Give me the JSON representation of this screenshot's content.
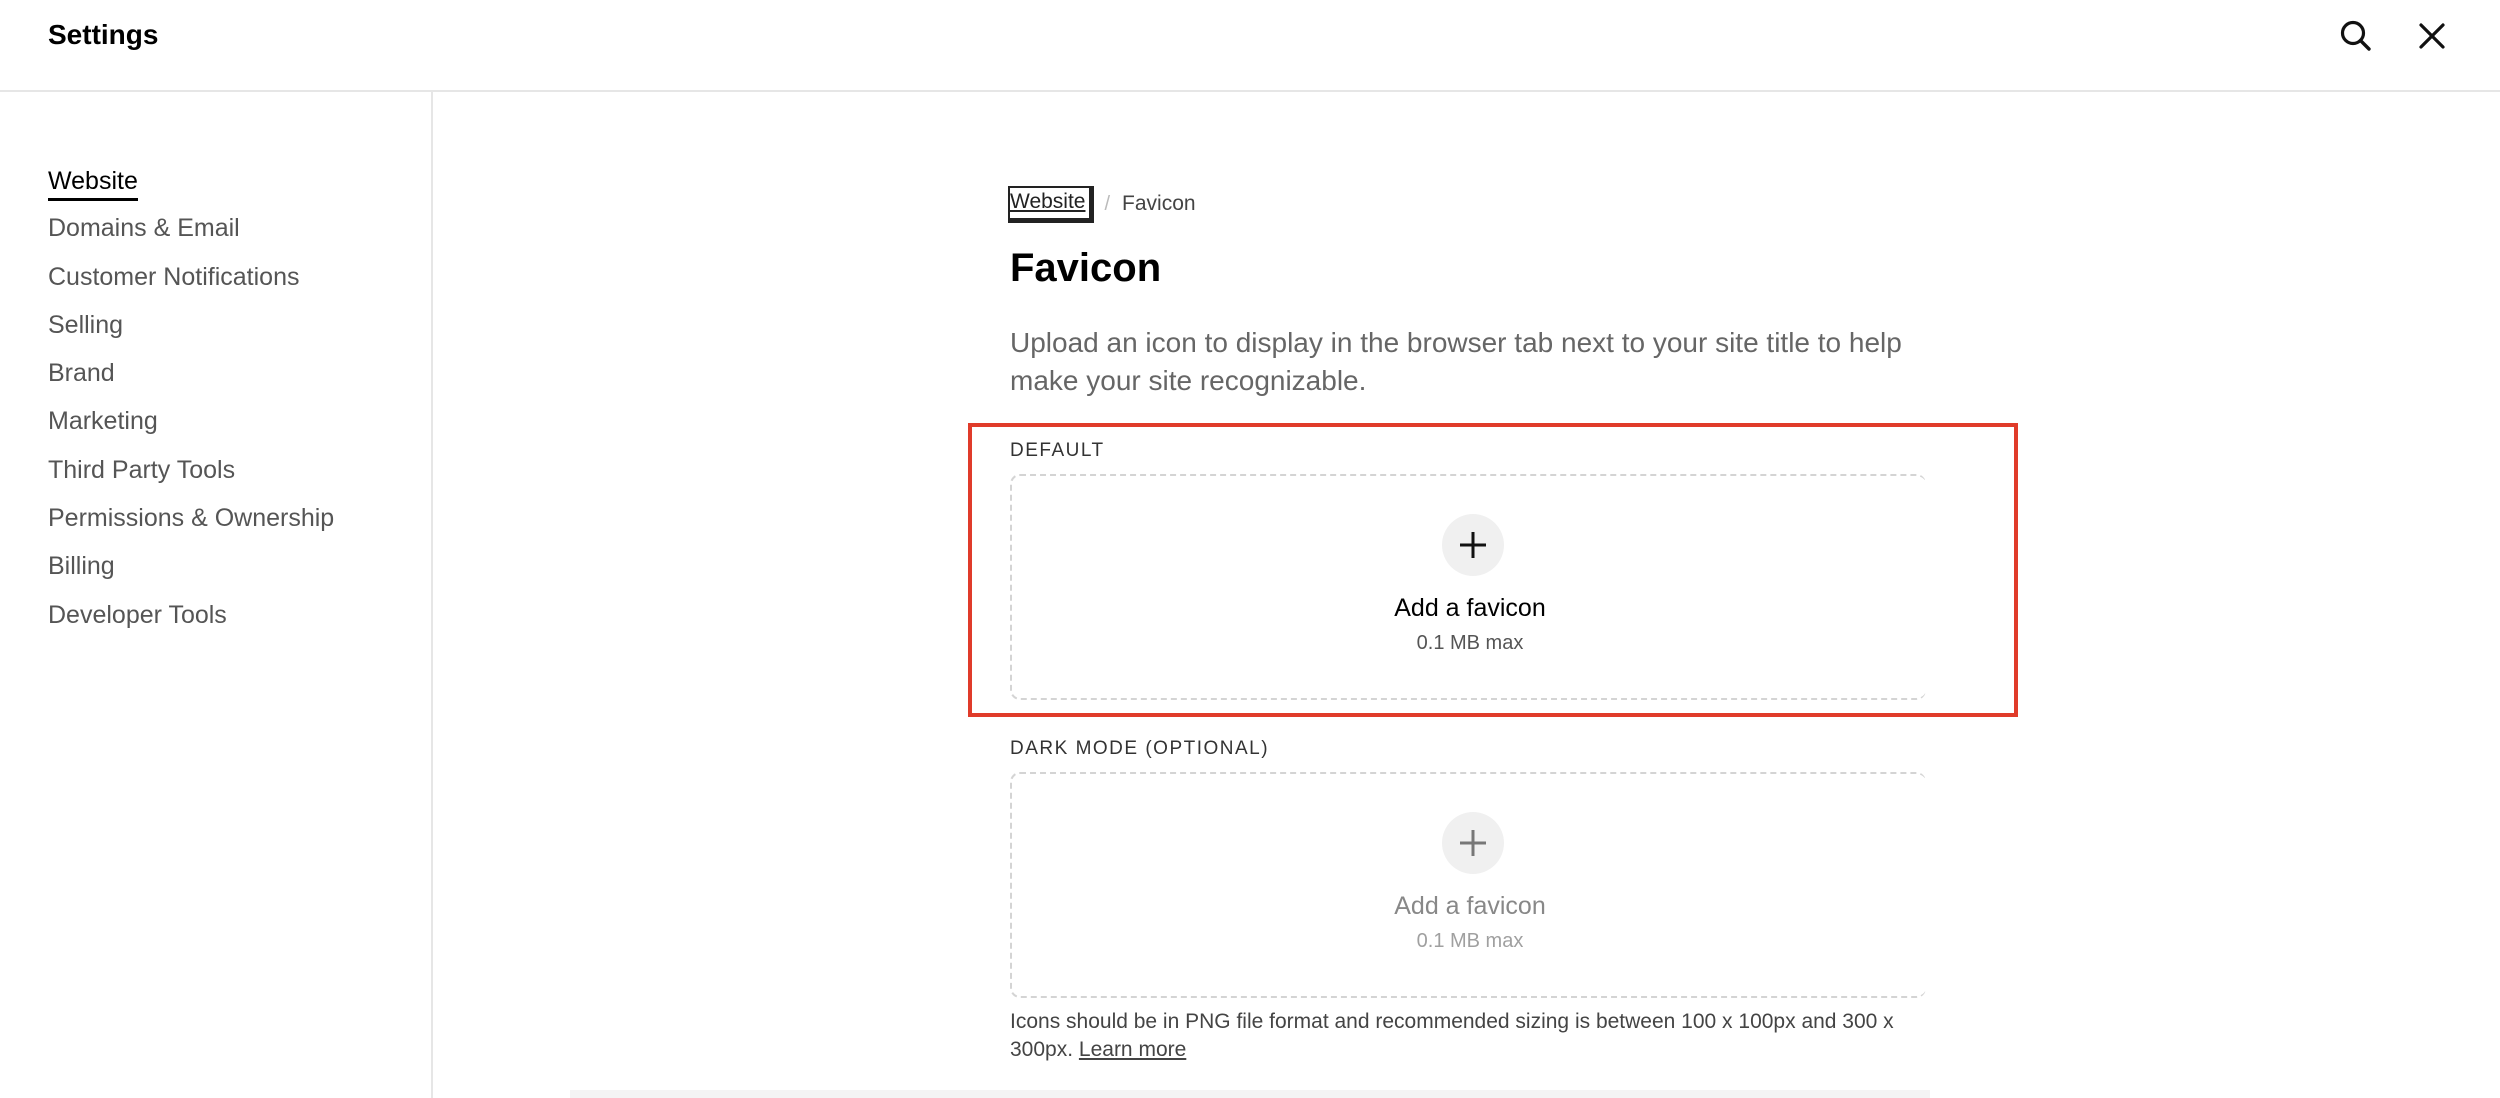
{
  "header": {
    "title": "Settings",
    "search_icon": "search-icon",
    "close_icon": "close-icon"
  },
  "sidebar": {
    "items": [
      {
        "label": "Website",
        "active": true
      },
      {
        "label": "Domains & Email"
      },
      {
        "label": "Customer Notifications"
      },
      {
        "label": "Selling"
      },
      {
        "label": "Brand"
      },
      {
        "label": "Marketing"
      },
      {
        "label": "Third Party Tools"
      },
      {
        "label": "Permissions & Ownership"
      },
      {
        "label": "Billing"
      },
      {
        "label": "Developer Tools"
      }
    ]
  },
  "breadcrumb": {
    "parent": "Website",
    "separator": "/",
    "current": "Favicon"
  },
  "main": {
    "title": "Favicon",
    "description": "Upload an icon to display in the browser tab next to your site title to help make your site recognizable.",
    "default_section": {
      "label": "DEFAULT",
      "upload_title": "Add a favicon",
      "upload_sub": "0.1 MB max"
    },
    "dark_section": {
      "label": "DARK MODE (OPTIONAL)",
      "upload_title": "Add a favicon",
      "upload_sub": "0.1 MB max"
    },
    "footnote_text": "Icons should be in PNG file format and recommended sizing is between 100 x 100px and 300 x 300px.",
    "footnote_link": "Learn more"
  },
  "colors": {
    "highlight": "#e03b2a",
    "text_primary": "#000000",
    "text_muted": "#666666"
  }
}
